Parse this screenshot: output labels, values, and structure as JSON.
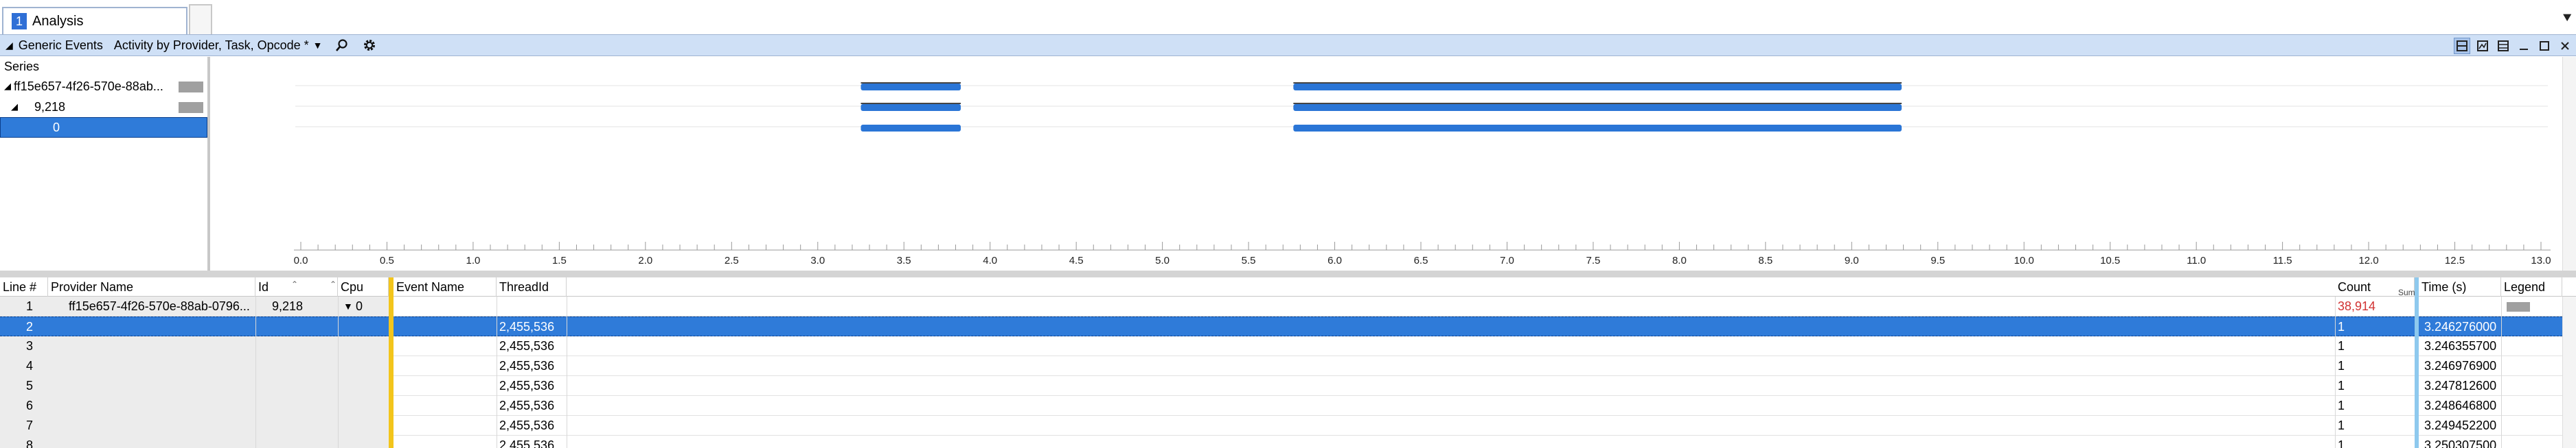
{
  "tabs": {
    "number": "1",
    "label": "Analysis",
    "menu_glyph": "⯆"
  },
  "panel": {
    "collapse_glyph": "◢",
    "title": "Generic Events",
    "preset": "Activity by Provider, Task, Opcode *",
    "preset_arrow": "▼",
    "search_glyph": "⚲",
    "settings_glyph": "⚙",
    "window_buttons": [
      "▣",
      "⧉",
      "▭",
      "—",
      "☐",
      "✕"
    ]
  },
  "series": {
    "title": "Series",
    "items": [
      {
        "label": "ff15e657-4f26-570e-88ab...",
        "expanded": true
      },
      {
        "label": "9,218",
        "expanded": true
      },
      {
        "label": "0",
        "selected": true
      }
    ]
  },
  "graph": {
    "axis_ticks": [
      "0.0",
      "0.5",
      "1.0",
      "1.5",
      "2.0",
      "2.5",
      "3.0",
      "3.5",
      "4.0",
      "4.5",
      "5.0",
      "5.5",
      "6.0",
      "6.5",
      "7.0",
      "7.5",
      "8.0",
      "8.5",
      "9.0",
      "9.5",
      "10.0",
      "10.5",
      "11.0",
      "11.5",
      "12.0",
      "12.5",
      "13.0"
    ],
    "axis_range": [
      0,
      13
    ],
    "lanes": 3,
    "activity_segments": [
      [
        3.25,
        3.83
      ],
      [
        5.76,
        9.29
      ]
    ],
    "bar_color": "#2a75d6"
  },
  "table": {
    "columns": [
      "Line #",
      "Provider Name",
      "Id",
      "Cpu",
      "Event Name",
      "ThreadId",
      "Count",
      "Time (s)",
      "Legend"
    ],
    "sum_label": "Sum",
    "group_row": {
      "line": "1",
      "provider": "ff15e657-4f26-570e-88ab-0796...",
      "id": "9,218",
      "cpu": "0",
      "cpu_glyph": "▼",
      "count": "38,914"
    },
    "rows": [
      {
        "line": "2",
        "thread": "2,455,536",
        "count": "1",
        "time": "3.246276000",
        "selected": true
      },
      {
        "line": "3",
        "thread": "2,455,536",
        "count": "1",
        "time": "3.246355700"
      },
      {
        "line": "4",
        "thread": "2,455,536",
        "count": "1",
        "time": "3.246976900"
      },
      {
        "line": "5",
        "thread": "2,455,536",
        "count": "1",
        "time": "3.247812600"
      },
      {
        "line": "6",
        "thread": "2,455,536",
        "count": "1",
        "time": "3.248646800"
      },
      {
        "line": "7",
        "thread": "2,455,536",
        "count": "1",
        "time": "3.249452200"
      },
      {
        "line": "8",
        "thread": "2,455,536",
        "count": "1",
        "time": "3.250307500"
      }
    ]
  }
}
